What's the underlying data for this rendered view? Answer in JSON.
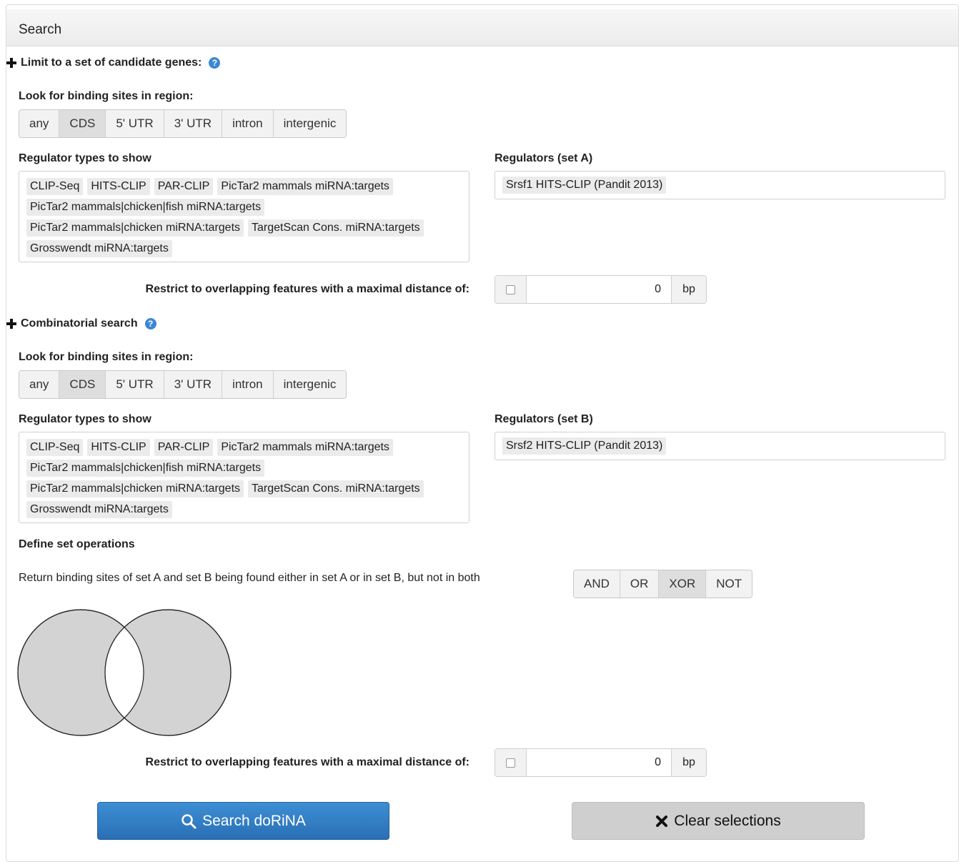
{
  "panel": {
    "title": "Search"
  },
  "candidate_genes": {
    "label": "Limit to a set of candidate genes:",
    "help_icon": "?"
  },
  "combinatorial": {
    "label": "Combinatorial search",
    "help_icon": "?"
  },
  "region_label": "Look for binding sites in region:",
  "regions": [
    "any",
    "CDS",
    "5' UTR",
    "3' UTR",
    "intron",
    "intergenic"
  ],
  "region_active": "CDS",
  "regtypes_label": "Regulator types to show",
  "regulator_types": {
    "line1": [
      "CLIP-Seq",
      "HITS-CLIP",
      "PAR-CLIP",
      "PicTar2 mammals miRNA:targets"
    ],
    "line2": [
      "PicTar2 mammals|chicken|fish miRNA:targets"
    ],
    "line3": [
      "PicTar2 mammals|chicken miRNA:targets",
      "TargetScan Cons. miRNA:targets"
    ],
    "line4": [
      "Grosswendt miRNA:targets"
    ]
  },
  "set_a": {
    "label": "Regulators (set A)",
    "value": "Srsf1 HITS-CLIP (Pandit 2013)"
  },
  "set_b": {
    "label": "Regulators (set B)",
    "value": "Srsf2 HITS-CLIP (Pandit 2013)"
  },
  "restrict": {
    "label": "Restrict to overlapping features with a maximal distance of:",
    "value": "0",
    "unit": "bp"
  },
  "set_ops": {
    "title": "Define set operations",
    "description": "Return binding sites of set A and set B being found either in set A or in set B, but not in both",
    "options": [
      "AND",
      "OR",
      "XOR",
      "NOT"
    ],
    "active": "XOR"
  },
  "actions": {
    "search": "Search doRiNA",
    "clear": "Clear selections"
  },
  "colors": {
    "primary": "#2a6fb5",
    "venn_fill": "#d3d3d3"
  }
}
